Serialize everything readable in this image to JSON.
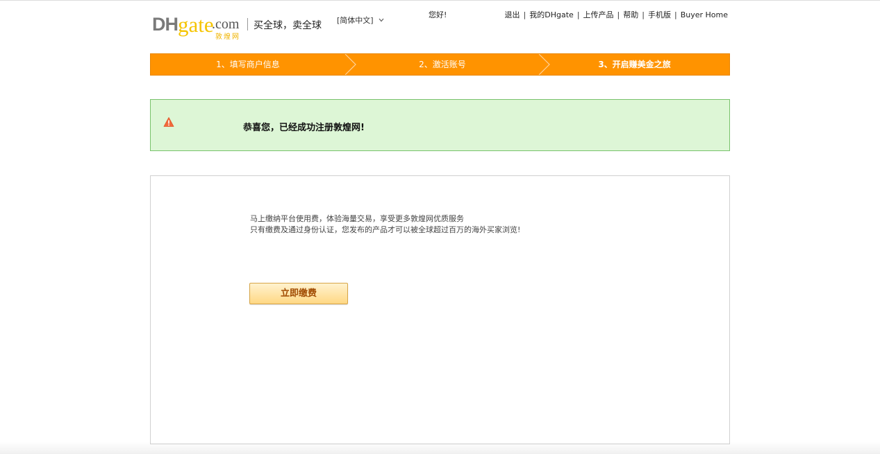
{
  "header": {
    "logo": {
      "dh": "DH",
      "gate": "gate",
      "com": ".com",
      "cn": "敦煌网"
    },
    "slogan": "买全球，卖全球",
    "language": "[简体中文]",
    "greeting": "您好!",
    "links": [
      {
        "label": "退出"
      },
      {
        "label": "我的DHgate"
      },
      {
        "label": "上传产品"
      },
      {
        "label": "帮助"
      },
      {
        "label": "手机版"
      },
      {
        "label": "Buyer Home"
      }
    ],
    "separator": "|"
  },
  "steps": [
    {
      "label": "1、填写商户信息",
      "active": false
    },
    {
      "label": "2、激活账号",
      "active": false
    },
    {
      "label": "3、开启赚美金之旅",
      "active": true
    }
  ],
  "success": {
    "message": "恭喜您，已经成功注册敦煌网!",
    "icon": "warning-triangle-icon"
  },
  "content": {
    "line1": "马上缴纳平台使用费，体验海量交易，享受更多敦煌网优质服务",
    "line2": "只有缴费及通过身份认证，您发布的产品才可以被全球超过百万的海外买家浏览!",
    "pay_button": "立即缴费"
  },
  "colors": {
    "accent": "#ff9300",
    "success_bg": "#ddf6d6",
    "success_border": "#78c26b",
    "warning_icon": "#f26a3d",
    "button_text": "#a04a00"
  }
}
